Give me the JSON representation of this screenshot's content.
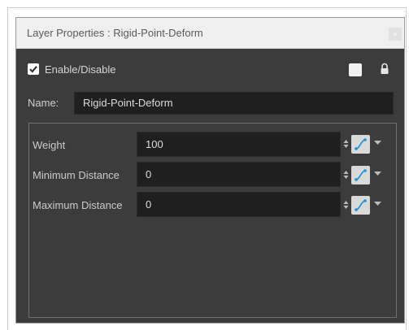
{
  "window": {
    "title": "Layer Properties : Rigid-Point-Deform",
    "close_glyph": "×"
  },
  "enable": {
    "label": "Enable/Disable",
    "checked": true
  },
  "name": {
    "label": "Name:",
    "value": "Rigid-Point-Deform"
  },
  "parameters": [
    {
      "label": "Weight",
      "value": "100"
    },
    {
      "label": "Minimum Distance",
      "value": "0"
    },
    {
      "label": "Maximum Distance",
      "value": "0"
    }
  ],
  "colors": {
    "panel_bg": "#3c3c3c",
    "field_bg": "#1f1f1f",
    "function_accent": "#1f8fd6"
  },
  "icons": [
    "checkbox-check-icon",
    "color-swatch-icon",
    "lock-icon",
    "spin-arrows-icon",
    "function-curve-icon",
    "dropdown-arrow-icon"
  ]
}
